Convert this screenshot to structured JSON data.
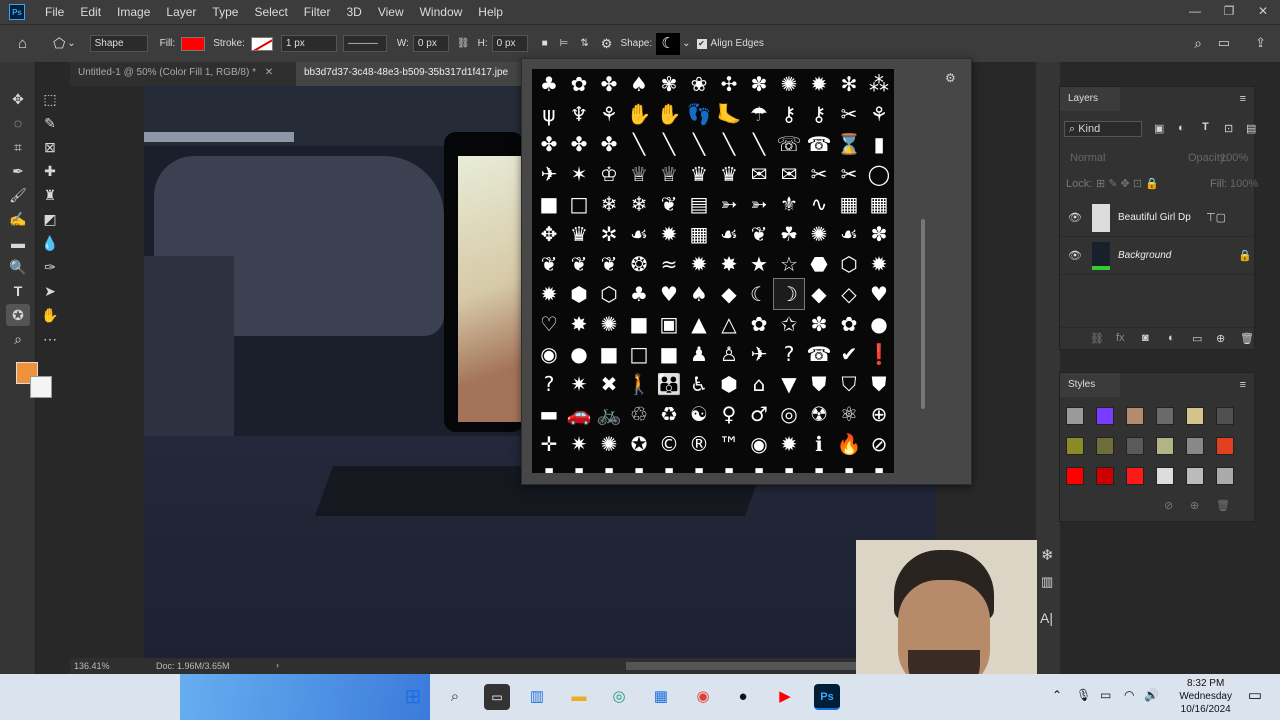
{
  "app": {
    "name": "Photoshop",
    "logo_text": "Ps"
  },
  "menu": [
    "File",
    "Edit",
    "Image",
    "Layer",
    "Type",
    "Select",
    "Filter",
    "3D",
    "View",
    "Window",
    "Help"
  ],
  "options_bar": {
    "mode": "Shape",
    "fill_label": "Fill:",
    "fill_color": "#ff0000",
    "stroke_label": "Stroke:",
    "stroke_width": "1 px",
    "w_label": "W:",
    "w_value": "0 px",
    "h_label": "H:",
    "h_value": "0 px",
    "shape_label": "Shape:",
    "align_edges": "Align Edges"
  },
  "tabs": [
    {
      "label": "Untitled-1 @ 50% (Color Fill 1, RGB/8) *"
    },
    {
      "label": "bb3d7d37-3c48-48e3-b509-35b317d1f417.jpe"
    }
  ],
  "status": {
    "zoom": "136.41%",
    "doc": "Doc: 1.96M/3.65M"
  },
  "shape_picker": {
    "shapes": [
      "♣",
      "✿",
      "✤",
      "♠",
      "✾",
      "❀",
      "✣",
      "✽",
      "✺",
      "✹",
      "✻",
      "⁂",
      "ψ",
      "♆",
      "⚘",
      "✋",
      "✋",
      "👣",
      "🦶",
      "☂",
      "⚷",
      "⚷",
      "✂",
      "⚘",
      "✤",
      "✤",
      "✤",
      "╲",
      "╲",
      "╲",
      "╲",
      "╲",
      "☏",
      "☎",
      "⌛",
      "▮",
      "✈",
      "✶",
      "♔",
      "♕",
      "♕",
      "♛",
      "♛",
      "✉",
      "✉",
      "✂",
      "✂",
      "◯",
      "■",
      "□",
      "❄",
      "❄",
      "❦",
      "▤",
      "➳",
      "➳",
      "⚜",
      "∿",
      "▦",
      "▦",
      "✥",
      "♛",
      "✲",
      "☙",
      "✹",
      "▦",
      "☙",
      "❦",
      "☘",
      "✺",
      "☙",
      "✽",
      "❦",
      "❦",
      "❦",
      "❂",
      "≈",
      "✹",
      "✸",
      "★",
      "☆",
      "⬣",
      "⬡",
      "✹",
      "✹",
      "⬢",
      "⬡",
      "♣",
      "♥",
      "♠",
      "◆",
      "☾",
      "☽",
      "◆",
      "◇",
      "♥",
      "♡",
      "✸",
      "✺",
      "■",
      "▣",
      "▲",
      "△",
      "✿",
      "✩",
      "✽",
      "✿",
      "●",
      "◉",
      "●",
      "■",
      "□",
      "■",
      "♟",
      "♙",
      "✈",
      "?",
      "☎",
      "✔",
      "❗",
      "?",
      "✷",
      "✖",
      "🚶",
      "👪",
      "♿",
      "⬢",
      "⌂",
      "▼",
      "⛊",
      "⛉",
      "⛊",
      "▬",
      "🚗",
      "🚲",
      "♲",
      "♻",
      "☯",
      "♀",
      "♂",
      "◎",
      "☢",
      "⚛",
      "⊕",
      "✛",
      "✷",
      "✺",
      "✪",
      "©",
      "®",
      "™",
      "◉",
      "✹",
      "ℹ",
      "🔥",
      "⊘",
      "▮",
      "▮",
      "▮",
      "▮",
      "▮",
      "▮",
      "▮",
      "▮",
      "▮",
      "▮",
      "▮",
      "▮"
    ]
  },
  "layers": {
    "tab_label": "Layers",
    "filter_label": "Kind",
    "blend_mode": "Normal",
    "opacity_label": "Opacity:",
    "opacity_value": "100%",
    "lock_label": "Lock:",
    "fill_label": "Fill:",
    "fill_value": "100%",
    "items": [
      {
        "name": "Beautiful Girl Dp"
      },
      {
        "name": "Background"
      }
    ]
  },
  "styles": {
    "tab_label": "Styles",
    "swatches": [
      "#9a9a9a",
      "#7a3cff",
      "#b58a6f",
      "#6a6a6a",
      "#d4c38a",
      "#505050",
      "#8a8a2a",
      "#6e6e3a",
      "#5a5a5a",
      "#b3b38a",
      "#888888",
      "#e04020",
      "#ff0000",
      "#cc0000",
      "#ff1a1a",
      "#dddddd",
      "#bbbbbb",
      "#aaaaaa"
    ]
  },
  "taskbar": {
    "time": "8:32 PM",
    "day": "Wednesday",
    "date": "10/16/2024"
  }
}
